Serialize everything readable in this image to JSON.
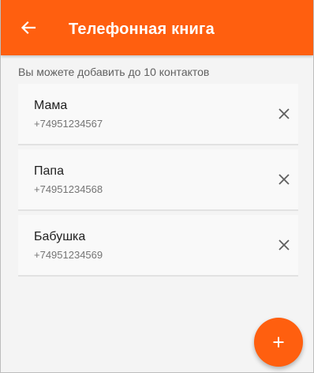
{
  "app_bar": {
    "back_icon": "arrow-left-icon",
    "title": "Телефонная книга",
    "background_color": "#ff5f0f"
  },
  "hint": "Вы можете добавить до 10 контактов",
  "contacts": [
    {
      "name": "Мама",
      "phone": "+74951234567",
      "remove_icon": "close-icon"
    },
    {
      "name": "Папа",
      "phone": "+74951234568",
      "remove_icon": "close-icon"
    },
    {
      "name": "Бабушка",
      "phone": "+74951234569",
      "remove_icon": "close-icon"
    }
  ],
  "fab": {
    "icon": "plus-icon",
    "color": "#ff5f0f"
  }
}
